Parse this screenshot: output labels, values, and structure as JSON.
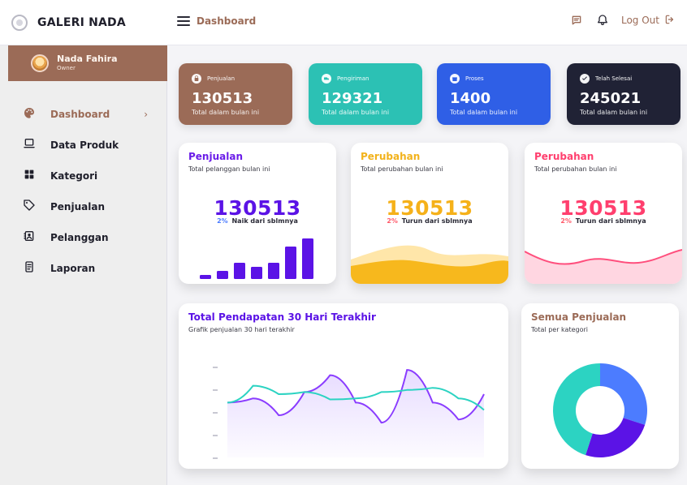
{
  "brand": {
    "name": "GALERI NADA"
  },
  "header": {
    "page_title": "Dashboard",
    "logout_label": "Log Out"
  },
  "profile": {
    "name": "Nada Fahira",
    "role": "Owner"
  },
  "sidebar": {
    "items": [
      {
        "label": "Dashboard",
        "icon": "palette-icon",
        "active": true
      },
      {
        "label": "Data Produk",
        "icon": "laptop-icon"
      },
      {
        "label": "Kategori",
        "icon": "grid-icon"
      },
      {
        "label": "Penjualan",
        "icon": "tag-icon"
      },
      {
        "label": "Pelanggan",
        "icon": "contact-icon"
      },
      {
        "label": "Laporan",
        "icon": "document-icon"
      }
    ],
    "chevron": "›"
  },
  "stats": [
    {
      "label": "Penjualan",
      "value": "130513",
      "sub": "Total dalam bulan ini",
      "color": "#9b6b57",
      "icon": "bag-icon"
    },
    {
      "label": "Pengiriman",
      "value": "129321",
      "sub": "Total dalam bulan ini",
      "color": "#2cc1b4",
      "icon": "truck-icon"
    },
    {
      "label": "Proses",
      "value": "1400",
      "sub": "Total dalam bulan ini",
      "color": "#2f5fe6",
      "icon": "gift-icon"
    },
    {
      "label": "Telah Selesai",
      "value": "245021",
      "sub": "Total dalam bulan ini",
      "color": "#202235",
      "icon": "check-icon"
    }
  ],
  "metrics": [
    {
      "title": "Penjualan",
      "subtitle": "Total pelanggan bulan ini",
      "value": "130513",
      "change_pct": "2%",
      "change_text": "Naik dari sblmnya",
      "title_color": "#6a1ce8",
      "value_color": "#5b13e6",
      "pct_color": "#4c7cff",
      "bars": [
        1,
        2,
        4,
        3,
        4,
        8,
        10
      ]
    },
    {
      "title": "Perubahan",
      "subtitle": "Total perubahan bulan ini",
      "value": "130513",
      "change_pct": "2%",
      "change_text": "Turun dari sblmnya",
      "title_color": "#f2b21b",
      "value_color": "#f5b11a",
      "pct_color": "#ff5a6a"
    },
    {
      "title": "Perubahan",
      "subtitle": "Total perubahan bulan ini",
      "value": "130513",
      "change_pct": "2%",
      "change_text": "Turun dari sblmnya",
      "title_color": "#ff3f6e",
      "value_color": "#ff3f6e",
      "pct_color": "#ff5a6a"
    }
  ],
  "revenue": {
    "title": "Total Pendapatan 30 Hari Terakhir",
    "subtitle": "Grafik penjualan 30 hari terakhir",
    "title_color": "#5b13e6",
    "series_purple": [
      0.52,
      0.56,
      0.4,
      0.62,
      0.78,
      0.52,
      0.33,
      0.83,
      0.52,
      0.36,
      0.6
    ],
    "series_teal": [
      0.52,
      0.68,
      0.6,
      0.62,
      0.55,
      0.56,
      0.62,
      0.64,
      0.66,
      0.56,
      0.45
    ]
  },
  "donut": {
    "title": "Semua Penjualan",
    "subtitle": "Total per kategori",
    "title_color": "#9b6b57",
    "slices": [
      {
        "value": 0.3,
        "color": "#4c7cff"
      },
      {
        "value": 0.25,
        "color": "#5b13e6"
      },
      {
        "value": 0.45,
        "color": "#2cd3c2"
      }
    ]
  }
}
